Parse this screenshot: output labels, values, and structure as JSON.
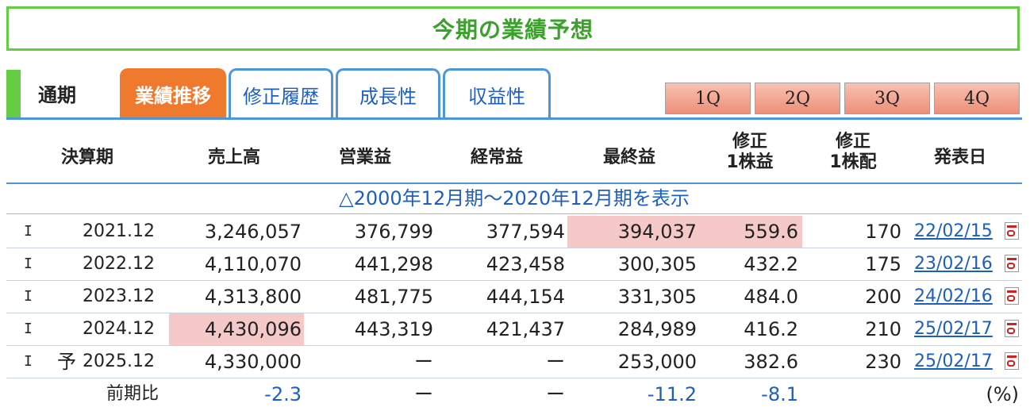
{
  "title": "今期の業績予想",
  "tabs": {
    "static": "通期",
    "active": "業績推移",
    "links": [
      "修正履歴",
      "成長性",
      "収益性"
    ],
    "quarters": [
      "1Q",
      "2Q",
      "3Q",
      "4Q"
    ]
  },
  "columns": {
    "period": "決算期",
    "sales": "売上高",
    "operating": "営業益",
    "ordinary": "経常益",
    "net": "最終益",
    "eps_line1": "修正",
    "eps_line2": "1株益",
    "dps_line1": "修正",
    "dps_line2": "1株配",
    "date": "発表日"
  },
  "range_link": "△2000年12月期〜2020年12月期を表示",
  "rows": [
    {
      "kind": "I",
      "mark": "",
      "period": "2021.12",
      "sales": "3,246,057",
      "operating": "376,799",
      "ordinary": "377,594",
      "net": "394,037",
      "eps": "559.6",
      "dps": "170",
      "date": "22/02/15"
    },
    {
      "kind": "I",
      "mark": "",
      "period": "2022.12",
      "sales": "4,110,070",
      "operating": "441,298",
      "ordinary": "423,458",
      "net": "300,305",
      "eps": "432.2",
      "dps": "175",
      "date": "23/02/16"
    },
    {
      "kind": "I",
      "mark": "",
      "period": "2023.12",
      "sales": "4,313,800",
      "operating": "481,775",
      "ordinary": "444,154",
      "net": "331,305",
      "eps": "484.0",
      "dps": "200",
      "date": "24/02/16"
    },
    {
      "kind": "I",
      "mark": "",
      "period": "2024.12",
      "sales": "4,430,096",
      "operating": "443,319",
      "ordinary": "421,437",
      "net": "284,989",
      "eps": "416.2",
      "dps": "210",
      "date": "25/02/17"
    },
    {
      "kind": "I",
      "mark": "予",
      "period": "2025.12",
      "sales": "4,330,000",
      "operating": "ー",
      "ordinary": "ー",
      "net": "253,000",
      "eps": "382.6",
      "dps": "230",
      "date": "25/02/17"
    }
  ],
  "yoy": {
    "label": "前期比",
    "sales": "-2.3",
    "operating": "ー",
    "ordinary": "ー",
    "net": "-11.2",
    "eps": "-8.1",
    "unit": "(%)"
  },
  "colors": {
    "accent_green": "#66cc44",
    "tab_orange": "#ef7a2e",
    "link_blue": "#1d5fbf",
    "highlight": "#f6c9c9"
  }
}
